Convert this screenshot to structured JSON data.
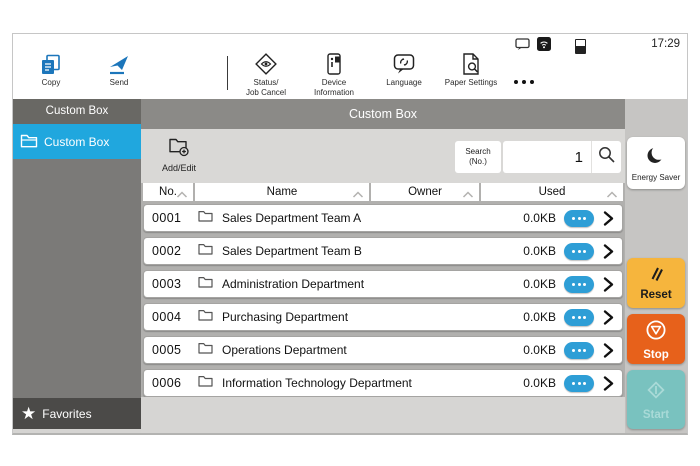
{
  "statusbar": {
    "time": "17:29",
    "icons": [
      "message-icon",
      "wifi-icon",
      "toner-level-icon"
    ]
  },
  "toolbar": {
    "items": [
      {
        "label": "Copy",
        "icon": "copy-icon"
      },
      {
        "label": "Send",
        "icon": "send-icon"
      },
      {
        "label": "Status/\nJob Cancel",
        "icon": "status-job-cancel-icon"
      },
      {
        "label": "Device\nInformation",
        "icon": "device-information-icon"
      },
      {
        "label": "Language",
        "icon": "language-icon"
      },
      {
        "label": "Paper Settings",
        "icon": "paper-settings-icon"
      },
      {
        "label": "",
        "icon": "more-ellipsis-icon"
      }
    ]
  },
  "sidebar": {
    "header": "Custom Box",
    "items": [
      {
        "label": "Custom Box",
        "icon": "folder-icon",
        "selected": true
      }
    ],
    "favorites_label": "Favorites"
  },
  "main": {
    "title": "Custom Box",
    "add_edit_label": "Add/Edit",
    "search_label": "Search\n(No.)",
    "search_value": "1",
    "table": {
      "headers": [
        "No.",
        "Name",
        "Owner",
        "Used"
      ],
      "sortable": true,
      "rows": [
        {
          "no": "0001",
          "name": "Sales Department Team A",
          "owner": "",
          "used": "0.0KB"
        },
        {
          "no": "0002",
          "name": "Sales Department Team B",
          "owner": "",
          "used": "0.0KB"
        },
        {
          "no": "0003",
          "name": "Administration Department",
          "owner": "",
          "used": "0.0KB"
        },
        {
          "no": "0004",
          "name": "Purchasing Department",
          "owner": "",
          "used": "0.0KB"
        },
        {
          "no": "0005",
          "name": "Operations Department",
          "owner": "",
          "used": "0.0KB"
        },
        {
          "no": "0006",
          "name": "Information Technology Department",
          "owner": "",
          "used": "0.0KB"
        }
      ]
    }
  },
  "actions": {
    "energy_saver": "Energy Saver",
    "reset": "Reset",
    "stop": "Stop",
    "start": "Start",
    "start_disabled": true
  },
  "colors": {
    "accent_blue": "#1c76bb",
    "selected_cyan": "#20a7de",
    "pill_blue": "#2e9ed6",
    "reset_yellow": "#f6b53d",
    "stop_orange": "#e7611b",
    "start_teal": "#79c2bf"
  }
}
